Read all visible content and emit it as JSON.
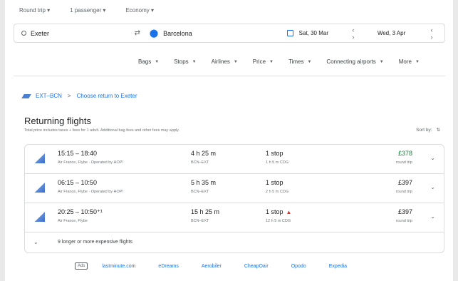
{
  "top_options": {
    "trip_type": "Round trip ▾",
    "passengers": "1 passenger ▾",
    "cabin": "Economy ▾"
  },
  "search": {
    "origin": "Exeter",
    "destination": "Barcelona",
    "depart_date": "Sat, 30 Mar",
    "return_date": "Wed, 3 Apr"
  },
  "filters": [
    {
      "label": "Bags"
    },
    {
      "label": "Stops"
    },
    {
      "label": "Airlines"
    },
    {
      "label": "Price"
    },
    {
      "label": "Times"
    },
    {
      "label": "Connecting airports"
    },
    {
      "label": "More"
    }
  ],
  "breadcrumb": {
    "route": "EXT–BCN",
    "separator": ">",
    "link": "Choose return to Exeter"
  },
  "results": {
    "title": "Returning flights",
    "subtitle": "Total price includes taxes + fees for 1 adult. Additional bag fees and other fees may apply.",
    "sort_label": "Sort by:",
    "flights": [
      {
        "times": "15:15 – 18:40",
        "airline": "Air France, Flybe · Operated by HOP!",
        "duration": "4 h 25 m",
        "route": "BCN–EXT",
        "stops": "1 stop",
        "layover": "1 h 5 m CDG",
        "price": "£378",
        "price_type": "round trip",
        "warning": false,
        "price_color": "#188038"
      },
      {
        "times": "06:15 – 10:50",
        "airline": "Air France, Flybe · Operated by HOP!",
        "duration": "5 h 35 m",
        "route": "BCN–EXT",
        "stops": "1 stop",
        "layover": "2 h 5 m CDG",
        "price": "£397",
        "price_type": "round trip",
        "warning": false,
        "price_color": "#202124"
      },
      {
        "times": "20:25 – 10:50⁺¹",
        "airline": "Air France, Flybe",
        "duration": "15 h 25 m",
        "route": "BCN–EXT",
        "stops": "1 stop",
        "layover": "12 h 5 m CDG",
        "price": "£397",
        "price_type": "round trip",
        "warning": true,
        "price_color": "#202124"
      }
    ],
    "more_flights": "9 longer or more expensive flights"
  },
  "footer": {
    "ads_label": "Ads",
    "links": [
      "lastminute.com",
      "eDreams",
      "Aerobiler",
      "CheapOair",
      "Opodo",
      "Expedia"
    ]
  },
  "icons": {
    "origin": "circle-icon",
    "swap": "swap-arrows-icon",
    "destination": "location-pin-icon",
    "calendar": "calendar-icon",
    "expand": "chevron-down-icon",
    "sort": "sort-icon",
    "warning": "warning-triangle-icon"
  },
  "colors": {
    "accent": "#1a73e8",
    "best_price": "#188038",
    "warning": "#d93025"
  }
}
